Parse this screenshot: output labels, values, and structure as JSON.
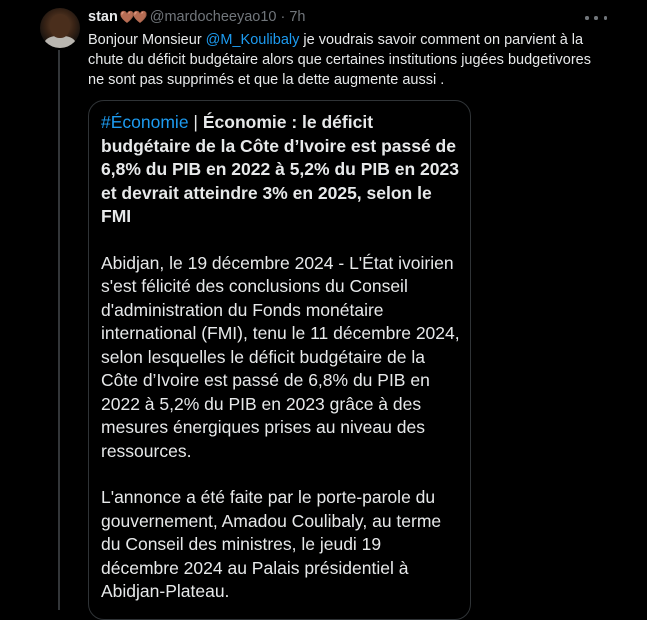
{
  "tweet": {
    "display_name": "stan",
    "name_emoji": "🤎🤎",
    "handle": "@mardocheeyao10",
    "separator": "·",
    "time": "7h",
    "text_start": "Bonjour Monsieur ",
    "mention": "@M_Koulibaly",
    "text_end": " je voudrais savoir comment on parvient à la chute du déficit budgétaire alors que certaines institutions jugées budgetivores  ne sont pas supprimés et que la dette augmente aussi ."
  },
  "card": {
    "hashtag": "#Économie",
    "title_separator": " | ",
    "title": "Économie : le déficit budgétaire de la Côte d’Ivoire est passé de 6,8% du PIB en 2022 à 5,2% du PIB en 2023 et devrait atteindre 3% en 2025, selon le FMI",
    "paragraph_1": "Abidjan, le 19 décembre 2024 - L'État ivoirien s'est félicité des conclusions du Conseil d'administration du Fonds monétaire international (FMI), tenu le 11 décembre 2024, selon lesquelles le déficit budgétaire de la Côte d’Ivoire est passé de 6,8% du PIB en 2022 à 5,2% du PIB en 2023 grâce à des mesures énergiques prises au niveau des ressources.",
    "paragraph_2": "L'annonce a été faite par le porte-parole du gouvernement, Amadou Coulibaly, au terme du Conseil des ministres, le jeudi 19 décembre 2024 au Palais présidentiel à Abidjan-Plateau."
  },
  "colors": {
    "background": "#000000",
    "text": "#e7e9ea",
    "secondary": "#71767b",
    "accent": "#1d9bf0",
    "border": "#2f3336"
  },
  "icons": {
    "more": "more-horizontal-icon",
    "avatar": "user-avatar"
  }
}
